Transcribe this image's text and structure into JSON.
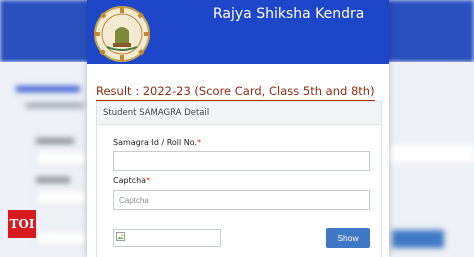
{
  "site": {
    "title": "Rajya Shiksha Kendra"
  },
  "result": {
    "title": "Result : 2022-23 (Score Card, Class 5th and 8th)"
  },
  "panel": {
    "heading": "Student SAMAGRA Detail"
  },
  "form": {
    "samagra": {
      "label": "Samagra Id / Roll No.",
      "required_mark": "*",
      "value": ""
    },
    "captcha": {
      "label": "Captcha",
      "required_mark": "*",
      "placeholder": "Captcha",
      "value": ""
    },
    "show_label": "Show"
  },
  "watermark": {
    "logo_text": "TOI"
  },
  "colors": {
    "header": "#1d46c9",
    "title": "#8e2d14",
    "underline": "#b22a1e",
    "button": "#3f78c4",
    "required": "#e0312a"
  }
}
